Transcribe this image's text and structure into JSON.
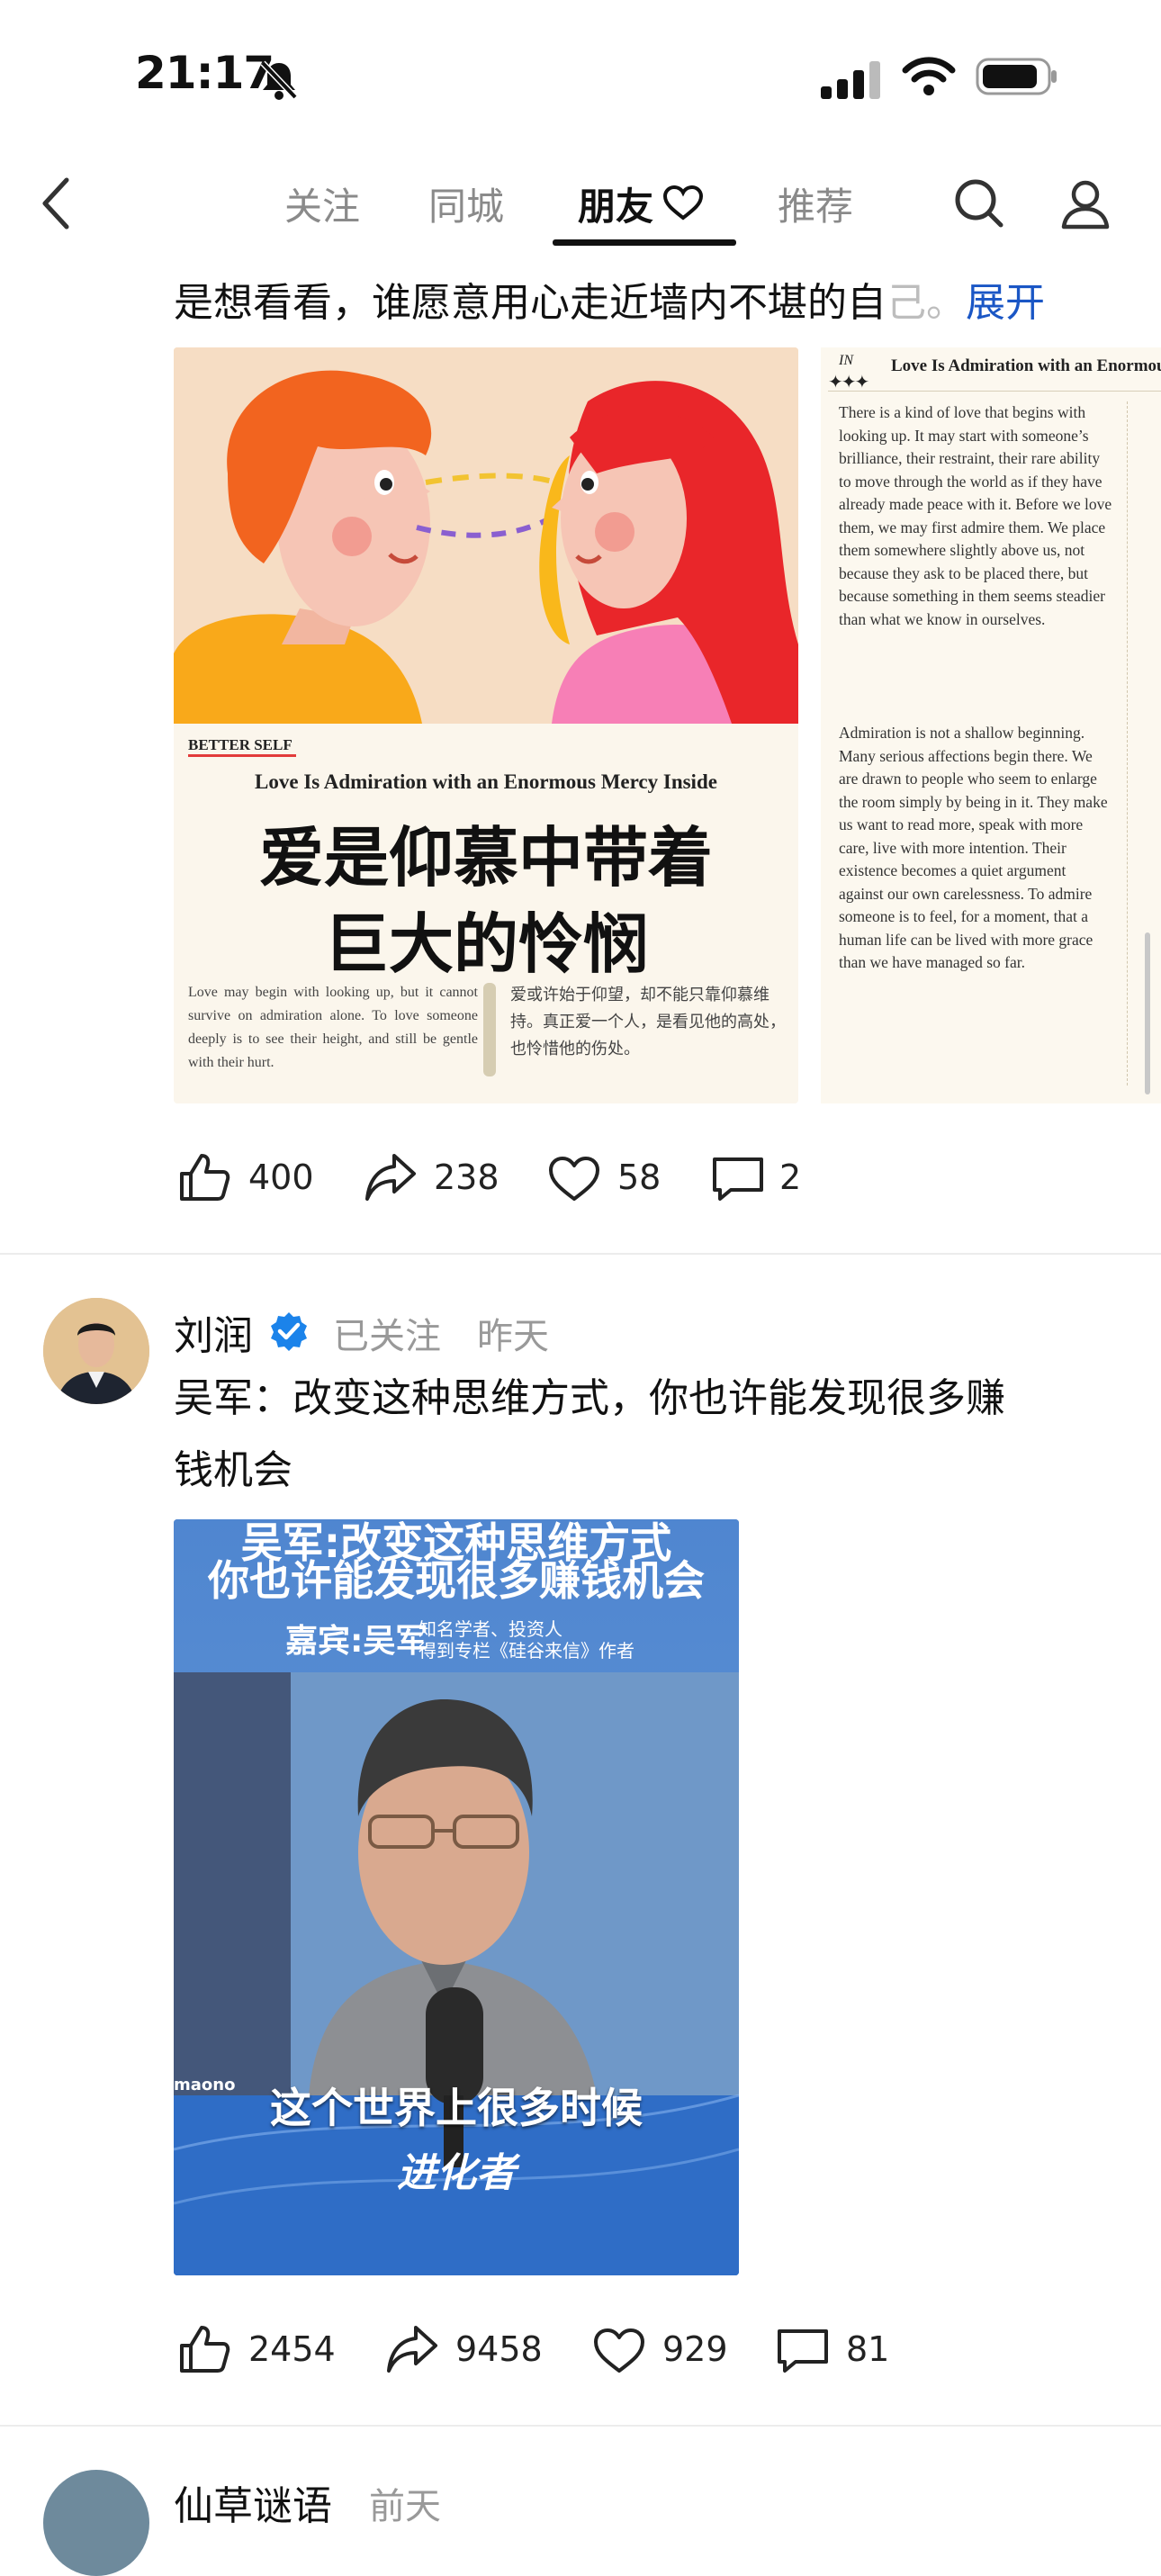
{
  "status_bar": {
    "time": "21:17"
  },
  "nav": {
    "tabs": [
      {
        "label": "关注"
      },
      {
        "label": "同城"
      },
      {
        "label": "朋友"
      },
      {
        "label": "推荐"
      }
    ]
  },
  "post1": {
    "text": "是想看看，谁愿意用心走近墙内不堪的自",
    "text_fade": "己。",
    "expand_label": "展开",
    "image_left": {
      "section_tag": "BETTER SELF",
      "title_en": "Love Is Admiration with an Enormous Mercy Inside",
      "title_cn_1": "爱是仰慕中带着",
      "title_cn_2": "巨大的怜悯",
      "summary_en": "Love may begin with looking up, but it cannot survive on admiration alone. To love someone deeply is to see their height, and still be gentle with their hurt.",
      "summary_cn": "爱或许始于仰望，却不能只靠仰慕维持。真正爱一个人，是看见他的高处，也怜惜他的伤处。"
    },
    "image_right": {
      "header_tag": "IN",
      "header_title": "Love Is Admiration with an Enormous",
      "para1": "There is a kind of love that begins with looking up. It may start with someone’s brilliance, their restraint, their rare ability to move through the world as if they have already made peace with it. Before we love them, we may first admire them. We place them somewhere slightly above us, not because they ask to be placed there, but because something in them seems steadier than what we know in ourselves.",
      "para2": "Admiration is not a shallow beginning. Many serious affections begin there. We are drawn to people who seem to enlarge the room simply by being in it. They make us want to read more, speak with more care, live with more intention. Their existence becomes a quiet argument against our own carelessness. To admire someone is to feel, for a moment, that a human life can be lived with more grace than we have managed so far."
    },
    "actions": {
      "likes": "400",
      "shares": "238",
      "favorites": "58",
      "comments": "2"
    }
  },
  "post2": {
    "author": "刘润",
    "follow_status": "已关注",
    "time": "昨天",
    "text_line1": "吴军：改变这种思维方式，你也许能发现很多赚",
    "text_line2": "钱机会",
    "video": {
      "title_top": "吴军:改变这种思维方式",
      "title_line2": "你也许能发现很多赚钱机会",
      "guest_label": "嘉宾:吴军",
      "guest_desc1": "知名学者、投资人",
      "guest_desc2": "得到专栏《硅谷来信》作者",
      "subtitle": "这个世界上很多时候",
      "logo": "进化者",
      "mic_brand": "maono"
    },
    "actions": {
      "likes": "2454",
      "shares": "9458",
      "favorites": "929",
      "comments": "81"
    }
  },
  "post3": {
    "author": "仙草谜语",
    "time": "前天"
  }
}
